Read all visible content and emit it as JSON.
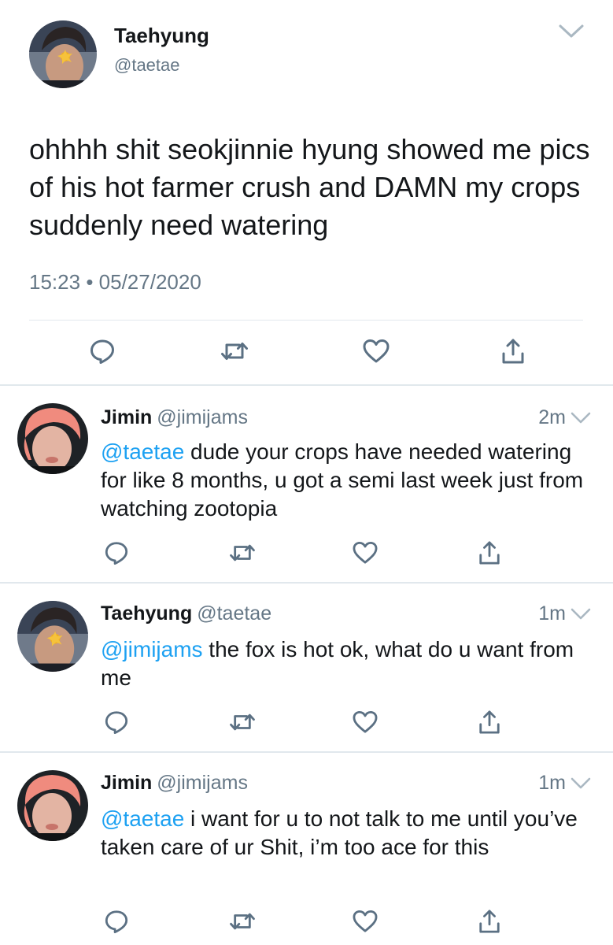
{
  "main_tweet": {
    "author_name": "Taehyung",
    "author_handle": "@taetae",
    "text": "ohhhh shit seokjinnie hyung showed me pics of his hot farmer crush and DAMN my crops suddenly need watering",
    "time": "15:23",
    "separator": "•",
    "date": "05/27/2020",
    "icons": [
      "reply-icon",
      "retweet-icon",
      "like-icon",
      "share-icon",
      "chevron-down-icon"
    ]
  },
  "replies": [
    {
      "author_name": "Jimin",
      "author_handle": "@jimijams",
      "age": "2m",
      "mention": "@taetae",
      "text": " dude your crops have needed watering for like 8 months, u got a semi last week just from watching zootopia"
    },
    {
      "author_name": "Taehyung",
      "author_handle": "@taetae",
      "age": "1m",
      "mention": "@jimijams",
      "text": " the fox is hot ok, what do u want from me"
    },
    {
      "author_name": "Jimin",
      "author_handle": "@jimijams",
      "age": "1m",
      "mention": "@taetae",
      "text": " i want for u to not talk to me until you’ve taken care of ur Shit, i’m too ace for this"
    }
  ],
  "colors": {
    "text": "#14171a",
    "secondary": "#657786",
    "link": "#1da1f2",
    "icon": "#5b7083",
    "divider": "#e1e8ed"
  }
}
